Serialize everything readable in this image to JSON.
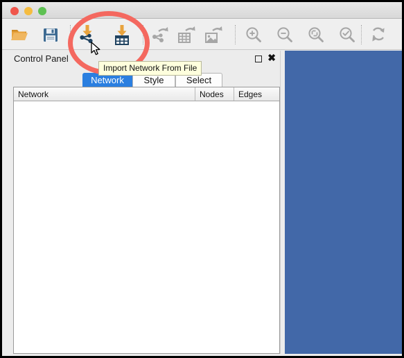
{
  "window": {
    "traffic_lights": [
      {
        "name": "close",
        "color": "#f0564c"
      },
      {
        "name": "minimize",
        "color": "#f5bc40"
      },
      {
        "name": "maximize",
        "color": "#5ec152"
      }
    ]
  },
  "toolbar": {
    "items": [
      {
        "name": "open-session-icon",
        "label": "Open Session",
        "enabled": true
      },
      {
        "name": "save-session-icon",
        "label": "Save Session",
        "enabled": true
      },
      {
        "name": "import-network-icon",
        "label": "Import Network From File",
        "enabled": true
      },
      {
        "name": "import-table-icon",
        "label": "Import Table From File",
        "enabled": true
      },
      {
        "name": "export-network-icon",
        "label": "Export Network",
        "enabled": false
      },
      {
        "name": "export-table-icon",
        "label": "Export Table",
        "enabled": false
      },
      {
        "name": "export-image-icon",
        "label": "Export Image",
        "enabled": false
      },
      {
        "name": "zoom-in-icon",
        "label": "Zoom In",
        "enabled": false
      },
      {
        "name": "zoom-out-icon",
        "label": "Zoom Out",
        "enabled": false
      },
      {
        "name": "zoom-fit-icon",
        "label": "Fit Network To Window",
        "enabled": false
      },
      {
        "name": "zoom-selected-icon",
        "label": "Fit Selected",
        "enabled": false
      },
      {
        "name": "refresh-icon",
        "label": "Refresh Network",
        "enabled": false
      }
    ]
  },
  "control_panel": {
    "title": "Control Panel",
    "float_label": "Float",
    "close_label": "✖",
    "tabs": [
      {
        "label": "Network",
        "active": true
      },
      {
        "label": "Style",
        "active": false
      },
      {
        "label": "Select",
        "active": false
      }
    ],
    "table": {
      "columns": [
        "Network",
        "Nodes",
        "Edges"
      ],
      "rows": []
    }
  },
  "tooltip": {
    "text": "Import Network From File"
  },
  "annotation": {
    "shape": "circle",
    "color": "#f4685f"
  },
  "network_view": {
    "background_color": "#4268a8"
  }
}
